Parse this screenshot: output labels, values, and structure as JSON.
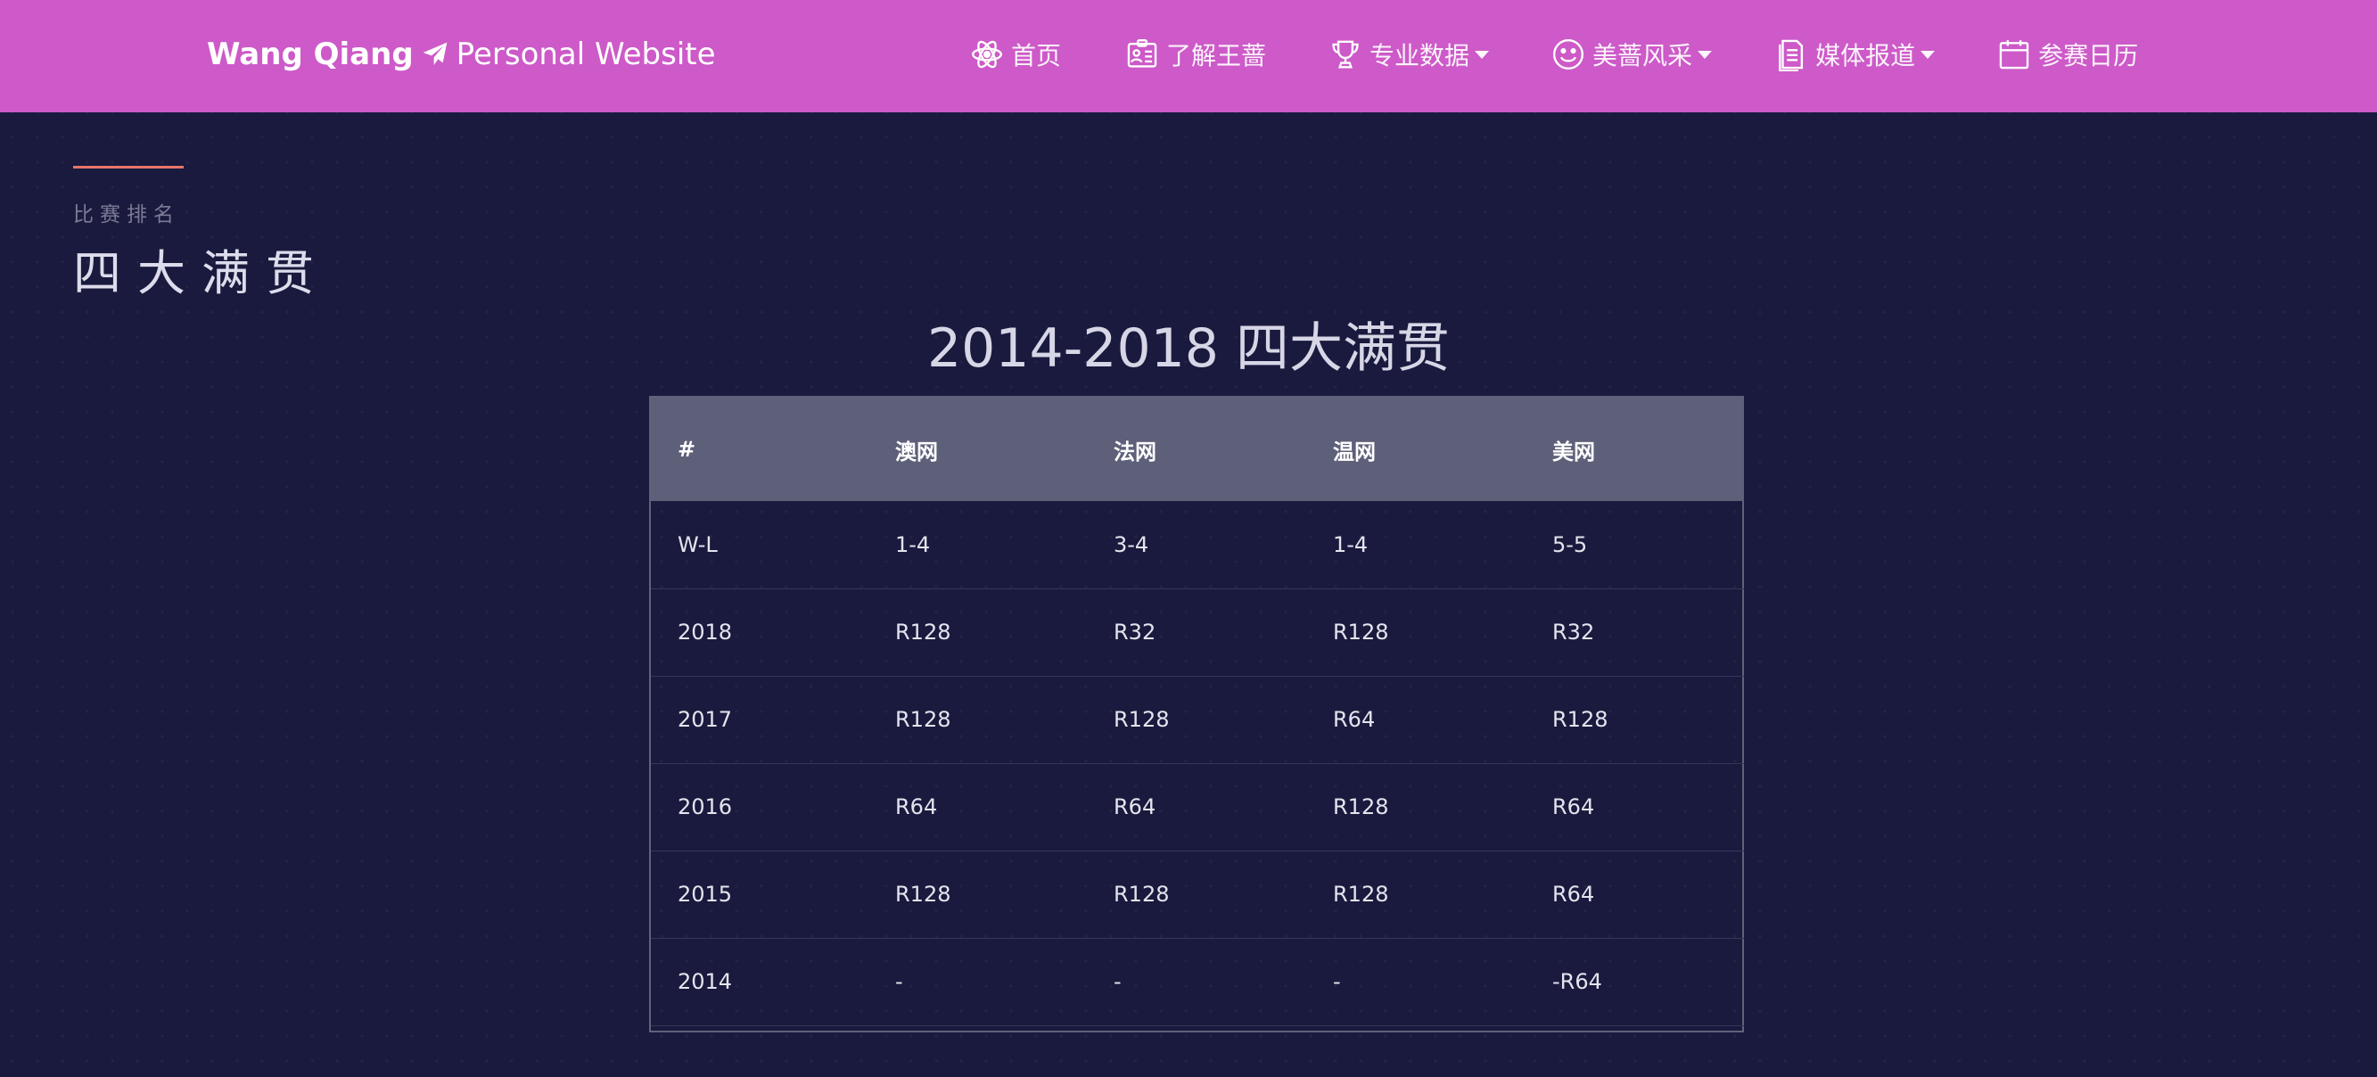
{
  "header": {
    "brand_bold": "Wang Qiang",
    "brand_rest": "Personal Website",
    "nav": [
      {
        "label": "首页",
        "icon": "atom-icon"
      },
      {
        "label": "了解王蔷",
        "icon": "id-badge-icon"
      },
      {
        "label": "专业数据",
        "icon": "trophy-icon",
        "dropdown": true
      },
      {
        "label": "美蔷风采",
        "icon": "smile-icon",
        "dropdown": true
      },
      {
        "label": "媒体报道",
        "icon": "document-icon",
        "dropdown": true
      },
      {
        "label": "参赛日历",
        "icon": "calendar-icon"
      }
    ]
  },
  "section": {
    "label": "比赛排名",
    "title": "四大满贯"
  },
  "table": {
    "title": "2014-2018 四大满贯",
    "headers": [
      "#",
      "澳网",
      "法网",
      "温网",
      "美网"
    ],
    "rows": [
      [
        "W-L",
        "1-4",
        "3-4",
        "1-4",
        "5-5"
      ],
      [
        "2018",
        "R128",
        "R32",
        "R128",
        "R32"
      ],
      [
        "2017",
        "R128",
        "R128",
        "R64",
        "R128"
      ],
      [
        "2016",
        "R64",
        "R64",
        "R128",
        "R64"
      ],
      [
        "2015",
        "R128",
        "R128",
        "R128",
        "R64"
      ],
      [
        "2014",
        "-",
        "-",
        "-",
        "-R64"
      ]
    ]
  },
  "colors": {
    "navbar": "#cd5ac8",
    "background": "#1a1a3e",
    "accent": "#e8756a",
    "table_header": "#5e607a"
  }
}
